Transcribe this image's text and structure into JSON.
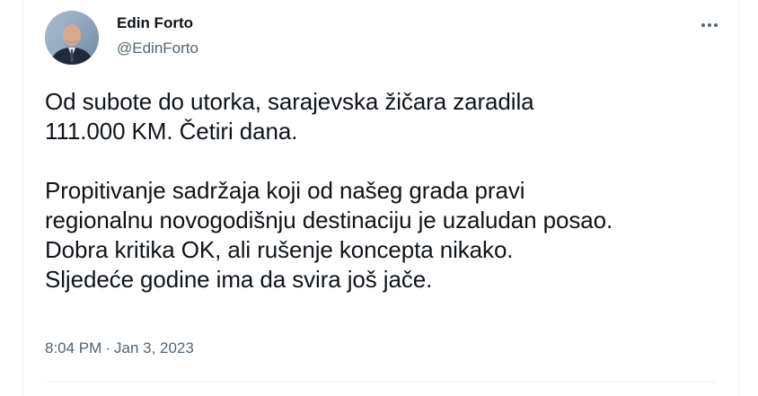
{
  "author": {
    "name": "Edin Forto",
    "handle": "@EdinForto",
    "avatar_icon": "profile-photo"
  },
  "menu": {
    "icon": "more-horizontal-icon"
  },
  "tweet": {
    "lines": [
      "Od subote do utorka, sarajevska žičara zaradila",
      "111.000 KM. Četiri dana.",
      "",
      "Propitivanje sadržaja koji od našeg grada pravi",
      "regionalnu novogodišnju destinaciju je uzaludan posao.",
      "Dobra kritika OK, ali rušenje koncepta nikako.",
      "Sljedeće godine ima da svira još jače."
    ]
  },
  "meta": {
    "time": "8:04 PM",
    "separator": "·",
    "date": "Jan 3, 2023"
  },
  "colors": {
    "text_primary": "#0f1419",
    "text_secondary": "#536471",
    "border": "#eff3f4"
  }
}
